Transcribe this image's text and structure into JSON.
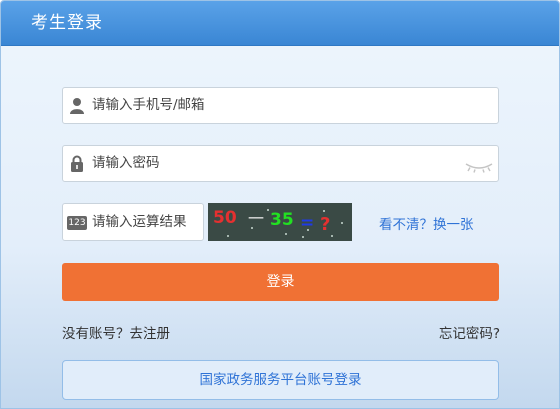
{
  "header": {
    "title": "考生登录"
  },
  "form": {
    "phone_placeholder": "请输入手机号/邮箱",
    "password_placeholder": "请输入密码",
    "captcha_placeholder": "请输入运算结果",
    "captcha_prefix_icon_text": "123",
    "captcha_image": {
      "num1": "50",
      "op": "一",
      "num2": "35",
      "equals": "=",
      "question": "?"
    },
    "refresh_captcha": "看不清？换一张",
    "login_button": "登录"
  },
  "links": {
    "register": "没有账号？去注册",
    "forgot": "忘记密码?",
    "gov_login": "国家政务服务平台账号登录"
  },
  "colors": {
    "header": "#3a86d4",
    "login_button": "#f07134",
    "link": "#2f73d6"
  }
}
